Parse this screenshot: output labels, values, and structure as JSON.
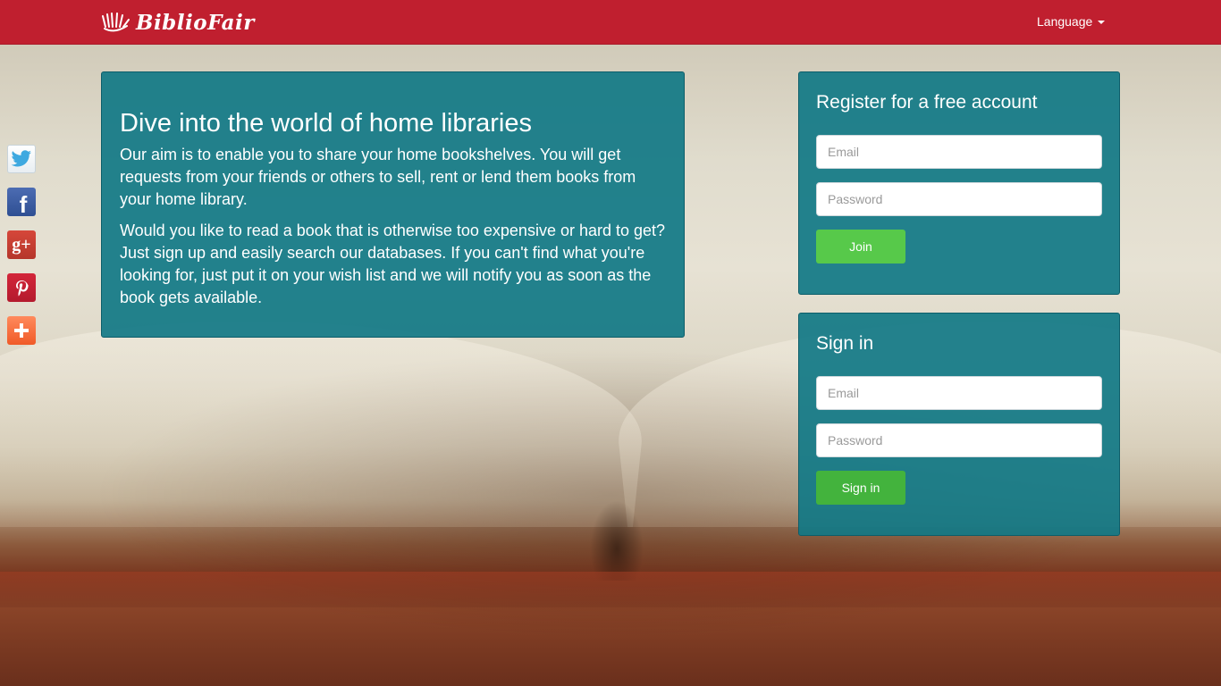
{
  "brand": {
    "name": "BiblioFair"
  },
  "nav": {
    "language_label": "Language"
  },
  "social": [
    {
      "name": "twitter-icon",
      "glyph": ""
    },
    {
      "name": "facebook-icon",
      "glyph": "f"
    },
    {
      "name": "google-plus-icon",
      "glyph": "g+"
    },
    {
      "name": "pinterest-icon",
      "glyph": "P"
    },
    {
      "name": "addthis-icon",
      "glyph": "+"
    }
  ],
  "intro": {
    "title": "Dive into the world of home libraries",
    "paragraph1": "Our aim is to enable you to share your home bookshelves. You will get requests from your friends or others to sell, rent or lend them books from your home library.",
    "paragraph2": "Would you like to read a book that is otherwise too expensive or hard to get? Just sign up and easily search our databases. If you can't find what you're looking for, just put it on your wish list and we will notify you as soon as the book gets available."
  },
  "register": {
    "title": "Register for a free account",
    "email_placeholder": "Email",
    "password_placeholder": "Password",
    "button_label": "Join"
  },
  "signin": {
    "title": "Sign in",
    "email_placeholder": "Email",
    "password_placeholder": "Password",
    "button_label": "Sign in"
  },
  "colors": {
    "navbar": "#c01f2f",
    "panel": "#117886",
    "join_button": "#57c94a",
    "signin_button": "#43b33d"
  }
}
